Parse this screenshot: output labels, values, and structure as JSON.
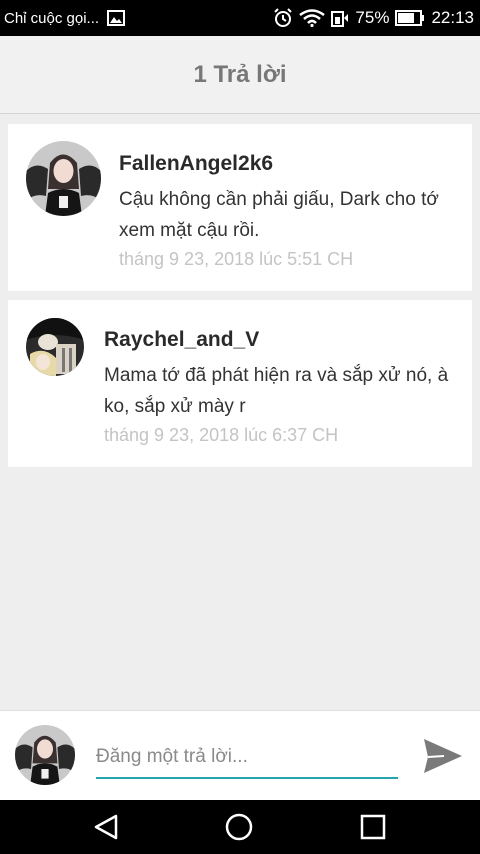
{
  "status_bar": {
    "carrier_text": "Chỉ cuộc gọi...",
    "battery_percent": "75%",
    "time": "22:13"
  },
  "header": {
    "title": "1 Trả lời"
  },
  "comments": [
    {
      "username": "FallenAngel2k6",
      "message": "Cậu không cần phải giấu, Dark cho tớ xem mặt cậu rồi.",
      "timestamp": "tháng 9 23, 2018 lúc 5:51 CH"
    },
    {
      "username": "Raychel_and_V",
      "message": "Mama tớ đã phát hiện ra và sắp xử nó, à ko, sắp xử mày r",
      "timestamp": "tháng 9 23, 2018 lúc 6:37 CH"
    }
  ],
  "reply": {
    "placeholder": "Đăng một trả lời..."
  },
  "colors": {
    "accent": "#26a4a8",
    "send_icon": "#7a7a7a",
    "timestamp": "#c4c4c4"
  },
  "icons": [
    "image-icon",
    "alarm-icon",
    "wifi-icon",
    "signal-icon",
    "battery-icon",
    "send-icon",
    "back-icon",
    "home-icon",
    "recents-icon"
  ]
}
